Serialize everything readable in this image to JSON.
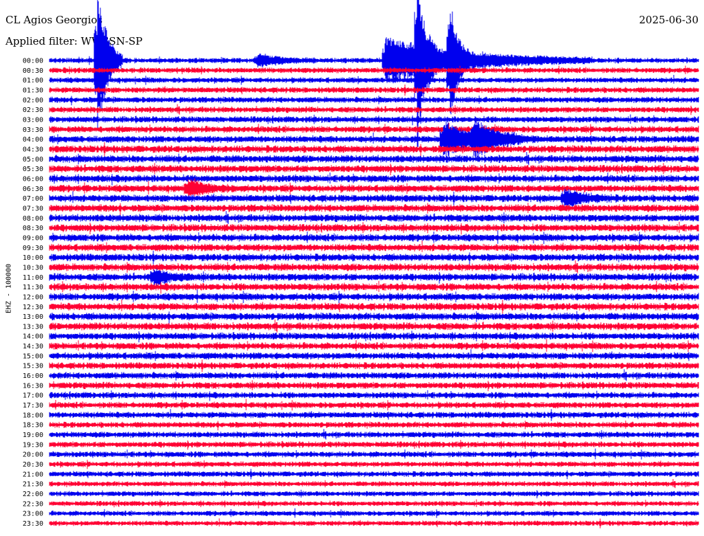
{
  "header": {
    "station": "CL Agios Georgios",
    "filter": "Applied filter: WWSSN-SP",
    "date": "2025-06-30",
    "channel": "EHZ - 100000"
  },
  "colors": {
    "trace_even": "#0000ee",
    "trace_odd": "#ff0033",
    "background": "#ffffff",
    "text": "#000000"
  },
  "chart_data": {
    "type": "helicorder",
    "title": "CL Agios Georgios",
    "subtitle": "Applied filter: WWSSN-SP",
    "date": "2025-06-30",
    "ylabel": "EHZ - 100000",
    "row_labels": [
      "00:00",
      "00:30",
      "01:00",
      "01:30",
      "02:00",
      "02:30",
      "03:00",
      "03:30",
      "04:00",
      "04:30",
      "05:00",
      "05:30",
      "06:00",
      "06:30",
      "07:00",
      "07:30",
      "08:00",
      "08:30",
      "09:00",
      "09:30",
      "10:00",
      "10:30",
      "11:00",
      "11:30",
      "12:00",
      "12:30",
      "13:00",
      "13:30",
      "14:00",
      "14:30",
      "15:00",
      "15:30",
      "16:00",
      "16:30",
      "17:00",
      "17:30",
      "18:00",
      "18:30",
      "19:00",
      "19:30",
      "20:00",
      "20:30",
      "21:00",
      "21:30",
      "22:00",
      "22:30",
      "23:00",
      "23:30"
    ],
    "row_minutes": 30,
    "noise_level": [
      0.7,
      0.75,
      0.75,
      0.8,
      0.8,
      0.8,
      0.85,
      0.9,
      0.95,
      1.0,
      1.0,
      1.0,
      1.0,
      1.0,
      1.0,
      1.0,
      1.0,
      1.0,
      1.0,
      1.0,
      1.0,
      1.0,
      1.0,
      1.0,
      1.0,
      1.0,
      1.0,
      1.0,
      0.95,
      0.95,
      0.95,
      0.9,
      0.9,
      0.9,
      0.85,
      0.85,
      0.85,
      0.8,
      0.8,
      0.8,
      0.8,
      0.75,
      0.75,
      0.7,
      0.7,
      0.7,
      0.7,
      0.7
    ],
    "events": [
      {
        "row": 0,
        "minute": 9.6,
        "amp": 2.2,
        "dur": 0.9
      },
      {
        "row": 0,
        "minute": 15.5,
        "amp": 8.0,
        "dur": 3.2
      },
      {
        "row": 0,
        "minute": 2.2,
        "amp": 30.0,
        "dur": 0.4
      },
      {
        "row": 0,
        "minute": 17.0,
        "amp": 28.0,
        "dur": 0.3
      },
      {
        "row": 0,
        "minute": 18.5,
        "amp": 22.0,
        "dur": 0.3
      },
      {
        "row": 8,
        "minute": 18.2,
        "amp": 6.0,
        "dur": 1.2
      },
      {
        "row": 8,
        "minute": 19.6,
        "amp": 5.0,
        "dur": 1.0
      },
      {
        "row": 13,
        "minute": 6.4,
        "amp": 2.5,
        "dur": 0.8
      },
      {
        "row": 14,
        "minute": 23.8,
        "amp": 3.0,
        "dur": 0.8
      },
      {
        "row": 22,
        "minute": 4.8,
        "amp": 2.5,
        "dur": 0.7
      }
    ]
  }
}
